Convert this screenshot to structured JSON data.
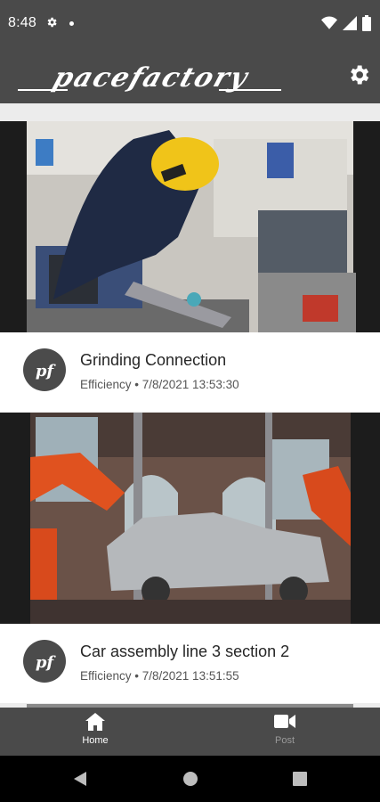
{
  "status_bar": {
    "time": "8:48",
    "icons": [
      "settings-icon",
      "notification-dot",
      "wifi-icon",
      "signal-icon",
      "battery-icon"
    ]
  },
  "app_bar": {
    "logo_text": "pacefactory",
    "settings_icon": "gear-icon"
  },
  "posts": [
    {
      "title": "Grinding Connection",
      "category": "Efficiency",
      "timestamp": "7/8/2021 13:53:30",
      "meta": "Efficiency • 7/8/2021 13:53:30",
      "image": "welder-workshop-photo",
      "avatar_text": "pf"
    },
    {
      "title": "Car assembly line 3 section 2",
      "category": "Efficiency",
      "timestamp": "7/8/2021 13:51:55",
      "meta": "Efficiency • 7/8/2021 13:51:55",
      "image": "car-assembly-robots-photo",
      "avatar_text": "pf"
    }
  ],
  "bottom_nav": {
    "items": [
      {
        "label": "Home",
        "icon": "home-icon",
        "active": true
      },
      {
        "label": "Post",
        "icon": "video-camera-icon",
        "active": false
      }
    ]
  },
  "system_nav": {
    "buttons": [
      "back-icon",
      "home-circle-icon",
      "recents-icon"
    ]
  },
  "colors": {
    "bar": "#4a4a4a",
    "feed_bg": "#ececec",
    "card_bg": "#ffffff",
    "avatar": "#4b4b4b",
    "nav_active": "#ffffff",
    "nav_inactive": "#9a9a9a"
  }
}
